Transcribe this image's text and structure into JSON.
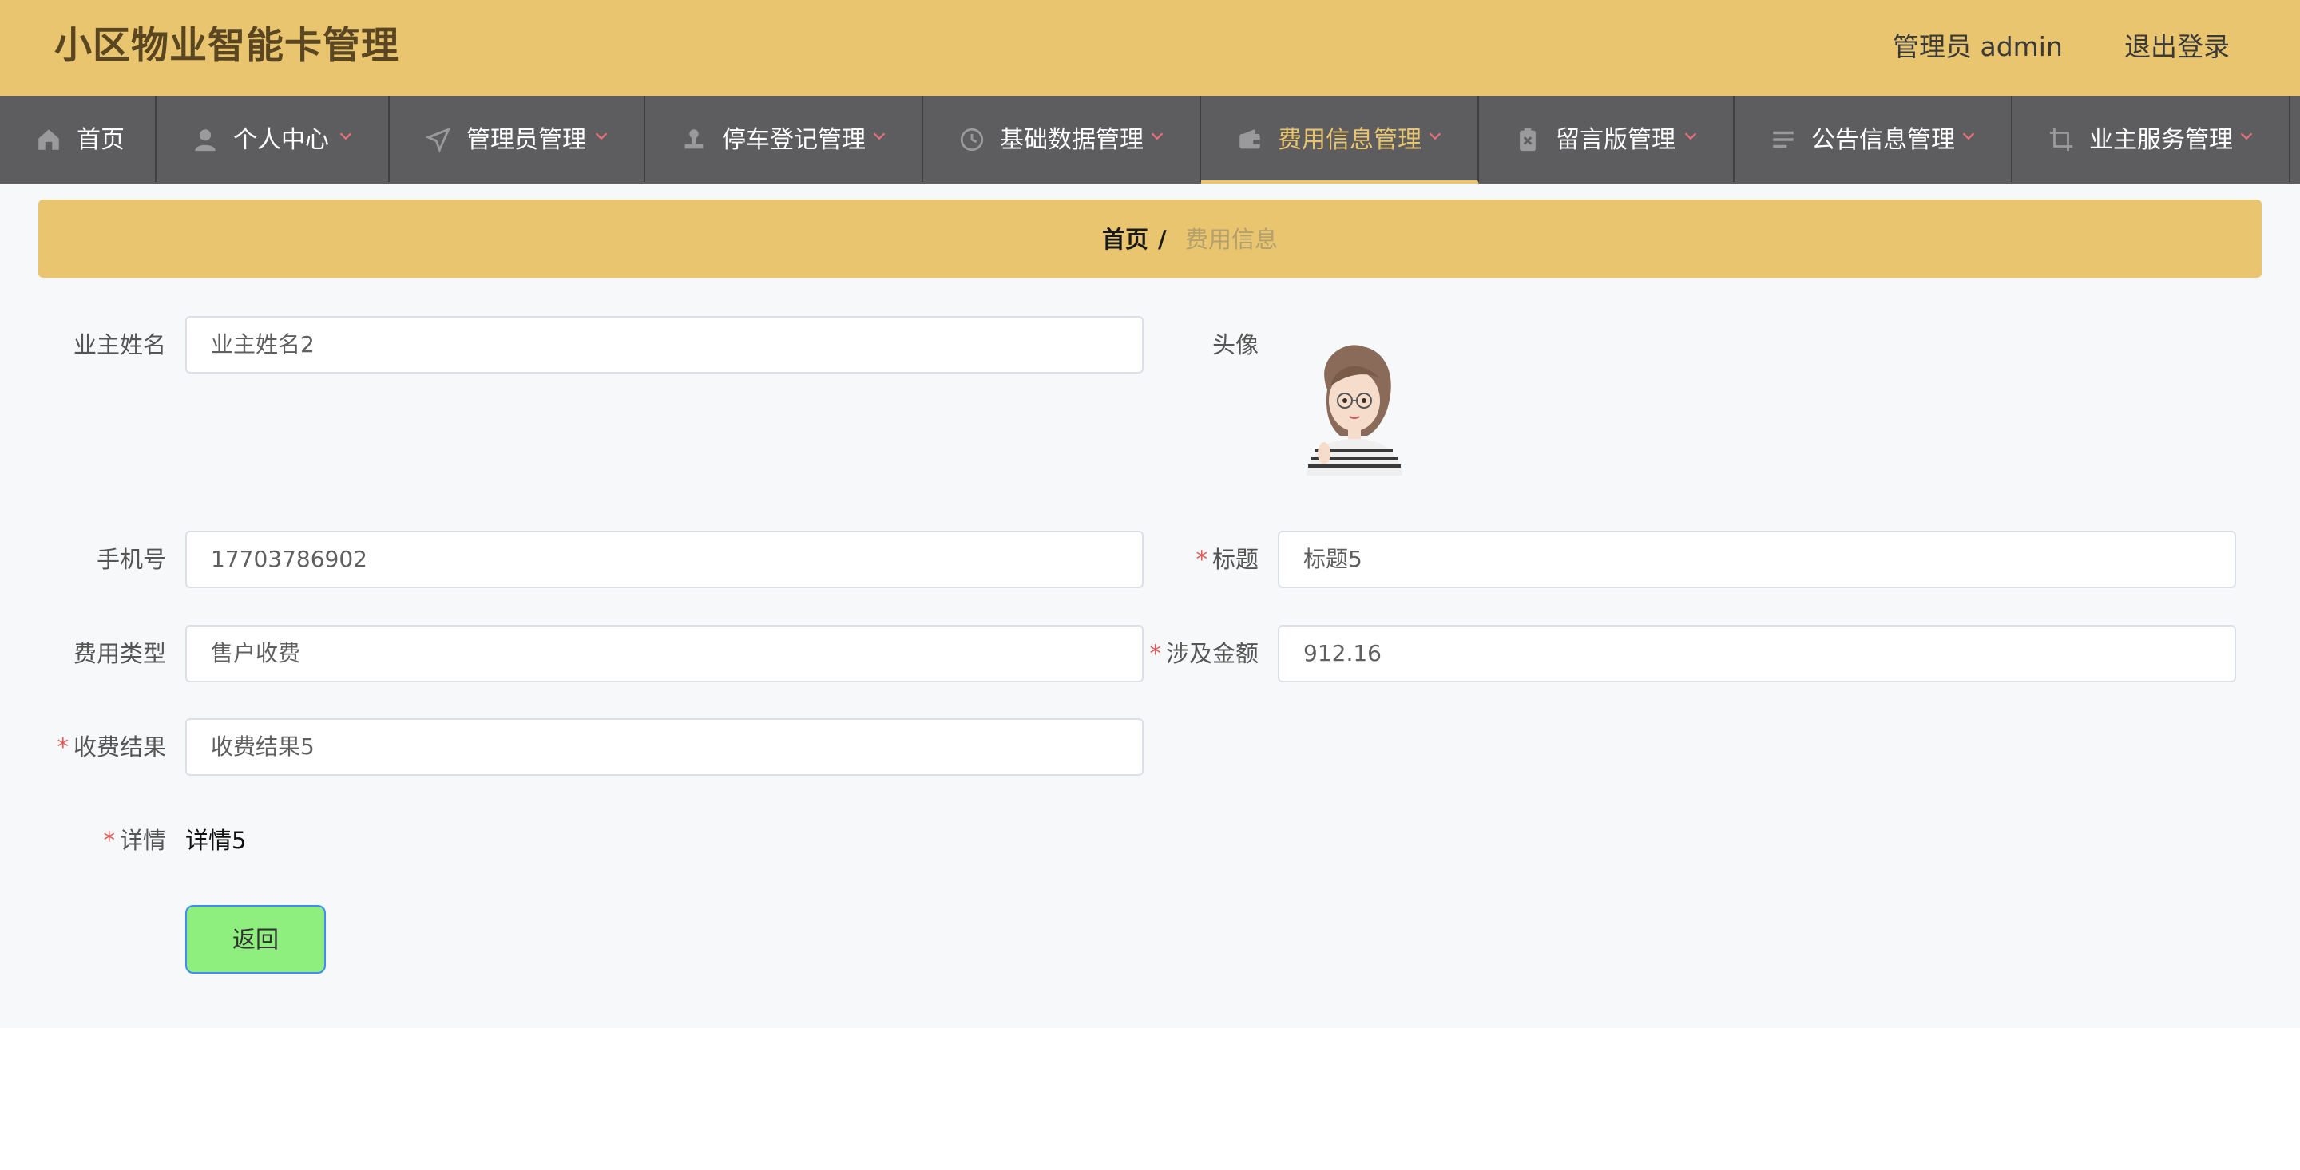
{
  "app": {
    "title": "小区物业智能卡管理"
  },
  "header": {
    "user": "管理员 admin",
    "logout": "退出登录"
  },
  "nav": [
    {
      "label": "首页",
      "icon": "home-icon",
      "dropdown": false
    },
    {
      "label": "个人中心",
      "icon": "user-icon",
      "dropdown": true
    },
    {
      "label": "管理员管理",
      "icon": "send-icon",
      "dropdown": true
    },
    {
      "label": "停车登记管理",
      "icon": "stamp-icon",
      "dropdown": true
    },
    {
      "label": "基础数据管理",
      "icon": "clock-icon",
      "dropdown": true
    },
    {
      "label": "费用信息管理",
      "icon": "wallet-icon",
      "dropdown": true,
      "active": true
    },
    {
      "label": "留言版管理",
      "icon": "clipboard-x-icon",
      "dropdown": true
    },
    {
      "label": "公告信息管理",
      "icon": "list-icon",
      "dropdown": true
    },
    {
      "label": "业主服务管理",
      "icon": "crop-icon",
      "dropdown": true
    }
  ],
  "breadcrumb": {
    "home": "首页",
    "sep": "/",
    "current": "费用信息"
  },
  "form": {
    "owner_name": {
      "label": "业主姓名",
      "value": "业主姓名2",
      "required": false
    },
    "avatar": {
      "label": "头像"
    },
    "phone": {
      "label": "手机号",
      "value": "17703786902",
      "required": false
    },
    "title": {
      "label": "标题",
      "value": "标题5",
      "required": true
    },
    "fee_type": {
      "label": "费用类型",
      "value": "售户收费",
      "required": false
    },
    "amount": {
      "label": "涉及金额",
      "value": "912.16",
      "required": true
    },
    "result": {
      "label": "收费结果",
      "value": "收费结果5",
      "required": true
    },
    "detail": {
      "label": "详情",
      "value": "详情5",
      "required": true
    },
    "required_mark": "*"
  },
  "actions": {
    "back": "返回"
  },
  "colors": {
    "accent": "#e8c56e",
    "nav_bg": "#5d5c5e",
    "back_button": "#8eee7e"
  }
}
